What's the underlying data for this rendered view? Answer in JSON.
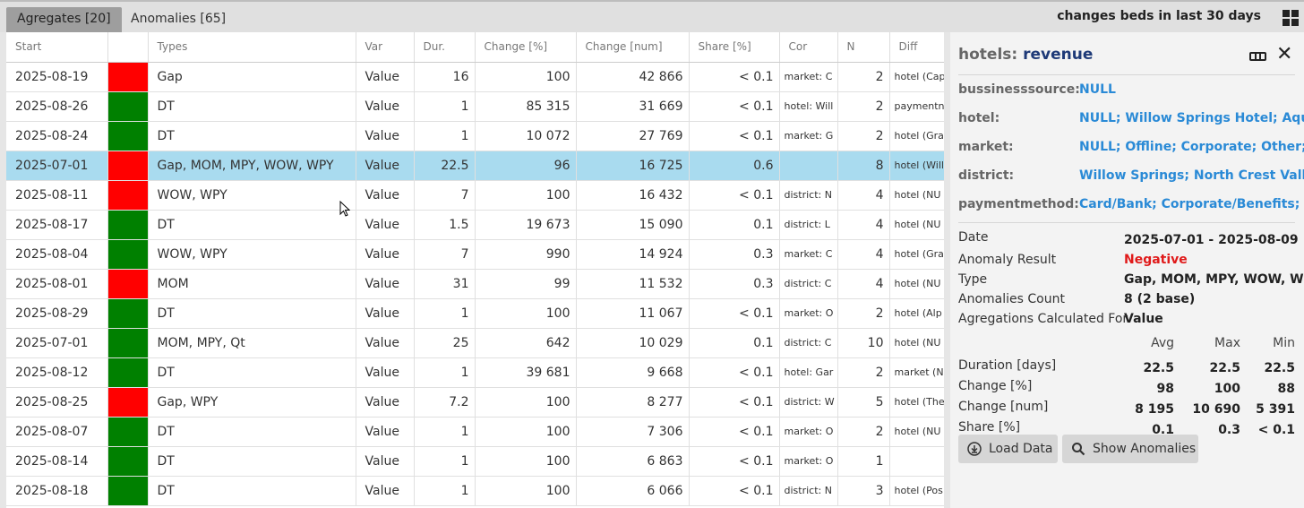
{
  "tabs": [
    {
      "label": "Agregates [20]",
      "active": true
    },
    {
      "label": "Anomalies [65]",
      "active": false
    }
  ],
  "top_title": "changes beds in last 30 days",
  "table": {
    "headers": [
      "Start",
      "",
      "Types",
      "Var",
      "Dur.",
      "Change [%]",
      "Change [num]",
      "Share [%]",
      "Cor",
      "N",
      "Diff"
    ],
    "rows": [
      {
        "start": "2025-08-19",
        "status": "red",
        "types": "Gap",
        "var": "Value",
        "dur": "16",
        "chg_pct": "100",
        "chg_num": "42 866",
        "share": "< 0.1",
        "cor": "market: C",
        "n": "2",
        "diff": "hotel (Cap"
      },
      {
        "start": "2025-08-26",
        "status": "green",
        "types": "DT",
        "var": "Value",
        "dur": "1",
        "chg_pct": "85 315",
        "chg_num": "31 669",
        "share": "< 0.1",
        "cor": "hotel: Will",
        "n": "2",
        "diff": "paymentn"
      },
      {
        "start": "2025-08-24",
        "status": "green",
        "types": "DT",
        "var": "Value",
        "dur": "1",
        "chg_pct": "10 072",
        "chg_num": "27 769",
        "share": "< 0.1",
        "cor": "market: G",
        "n": "2",
        "diff": "hotel (Gra"
      },
      {
        "start": "2025-07-01",
        "status": "red",
        "types": "Gap, MOM, MPY, WOW, WPY",
        "var": "Value",
        "dur": "22.5",
        "chg_pct": "96",
        "chg_num": "16 725",
        "share": "0.6",
        "cor": "",
        "n": "8",
        "diff": "hotel (Will",
        "selected": true
      },
      {
        "start": "2025-08-11",
        "status": "red",
        "types": "WOW, WPY",
        "var": "Value",
        "dur": "7",
        "chg_pct": "100",
        "chg_num": "16 432",
        "share": "< 0.1",
        "cor": "district: N",
        "n": "4",
        "diff": "hotel (NU"
      },
      {
        "start": "2025-08-17",
        "status": "green",
        "types": "DT",
        "var": "Value",
        "dur": "1.5",
        "chg_pct": "19 673",
        "chg_num": "15 090",
        "share": "0.1",
        "cor": "district: L",
        "n": "4",
        "diff": "hotel (NU"
      },
      {
        "start": "2025-08-04",
        "status": "green",
        "types": "WOW, WPY",
        "var": "Value",
        "dur": "7",
        "chg_pct": "990",
        "chg_num": "14 924",
        "share": "0.3",
        "cor": "market: C",
        "n": "4",
        "diff": "hotel (Gra"
      },
      {
        "start": "2025-08-01",
        "status": "red",
        "types": "MOM",
        "var": "Value",
        "dur": "31",
        "chg_pct": "99",
        "chg_num": "11 532",
        "share": "0.3",
        "cor": "district: C",
        "n": "4",
        "diff": "hotel (NU"
      },
      {
        "start": "2025-08-29",
        "status": "green",
        "types": "DT",
        "var": "Value",
        "dur": "1",
        "chg_pct": "100",
        "chg_num": "11 067",
        "share": "< 0.1",
        "cor": "market: O",
        "n": "2",
        "diff": "hotel (Alp"
      },
      {
        "start": "2025-07-01",
        "status": "green",
        "types": "MOM, MPY, Qt",
        "var": "Value",
        "dur": "25",
        "chg_pct": "642",
        "chg_num": "10 029",
        "share": "0.1",
        "cor": "district: C",
        "n": "10",
        "diff": "hotel (NU"
      },
      {
        "start": "2025-08-12",
        "status": "green",
        "types": "DT",
        "var": "Value",
        "dur": "1",
        "chg_pct": "39 681",
        "chg_num": "9 668",
        "share": "< 0.1",
        "cor": "hotel: Gar",
        "n": "2",
        "diff": "market (N"
      },
      {
        "start": "2025-08-25",
        "status": "red",
        "types": "Gap, WPY",
        "var": "Value",
        "dur": "7.2",
        "chg_pct": "100",
        "chg_num": "8 277",
        "share": "< 0.1",
        "cor": "district: W",
        "n": "5",
        "diff": "hotel (The"
      },
      {
        "start": "2025-08-07",
        "status": "green",
        "types": "DT",
        "var": "Value",
        "dur": "1",
        "chg_pct": "100",
        "chg_num": "7 306",
        "share": "< 0.1",
        "cor": "market: O",
        "n": "2",
        "diff": "hotel (NU"
      },
      {
        "start": "2025-08-14",
        "status": "green",
        "types": "DT",
        "var": "Value",
        "dur": "1",
        "chg_pct": "100",
        "chg_num": "6 863",
        "share": "< 0.1",
        "cor": "market: O",
        "n": "1",
        "diff": ""
      },
      {
        "start": "2025-08-18",
        "status": "green",
        "types": "DT",
        "var": "Value",
        "dur": "1",
        "chg_pct": "100",
        "chg_num": "6 066",
        "share": "< 0.1",
        "cor": "district: N",
        "n": "3",
        "diff": "hotel (Pos"
      }
    ]
  },
  "panel": {
    "entity": "hotels:",
    "metric": "revenue",
    "filters": [
      {
        "key": "bussinesssource:",
        "value": "NULL"
      },
      {
        "key": "hotel:",
        "value": "NULL; Willow Springs Hotel; Aqu"
      },
      {
        "key": "market:",
        "value": "NULL; Offline; Corporate; Other;"
      },
      {
        "key": "district:",
        "value": "Willow Springs; North Crest Valle"
      },
      {
        "key": "paymentmethod:",
        "value": "Card/Bank; Corporate/Benefits; ("
      }
    ],
    "details": {
      "date_label": "Date",
      "date_value": "2025-07-01  -  2025-08-09",
      "result_label": "Anomaly Result",
      "result_value": "Negative",
      "type_label": "Type",
      "type_value": "Gap, MOM, MPY, WOW, WPY",
      "count_label": "Anomalies Count",
      "count_value": "8 (2 base)",
      "agg_label": "Agregations Calculated For",
      "agg_value": "Value"
    },
    "stats": {
      "headers": [
        "Avg",
        "Max",
        "Min"
      ],
      "rows": [
        {
          "label": "Duration [days]",
          "avg": "22.5",
          "max": "22.5",
          "min": "22.5"
        },
        {
          "label": "Change [%]",
          "avg": "98",
          "max": "100",
          "min": "88"
        },
        {
          "label": "Change [num]",
          "avg": "8 195",
          "max": "10 690",
          "min": "5 391"
        },
        {
          "label": "Share [%]",
          "avg": "0.1",
          "max": "0.3",
          "min": "< 0.1"
        }
      ]
    },
    "buttons": {
      "load": "Load Data",
      "show": "Show Anomalies"
    }
  },
  "colors": {
    "red": "#ff0000",
    "green": "#008000",
    "selected_row": "#a9dbef",
    "link": "#2a8ad6",
    "negative": "#e01a1a"
  }
}
